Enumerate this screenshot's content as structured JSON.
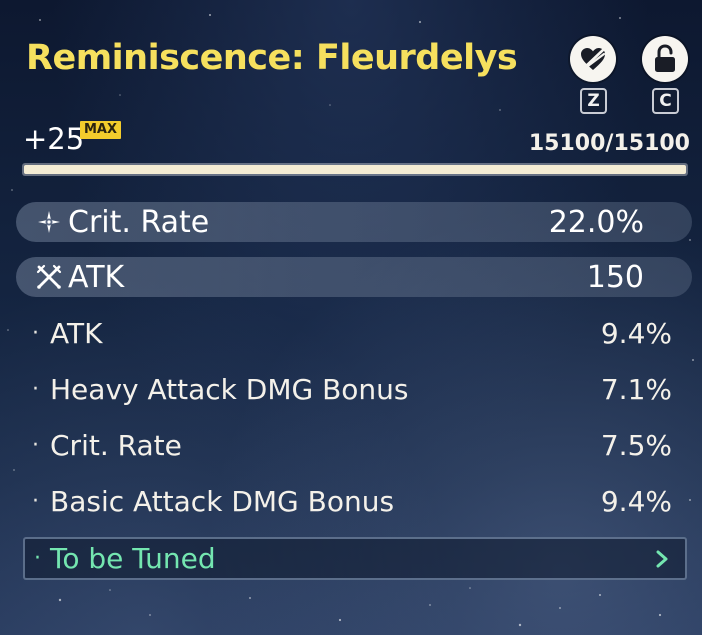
{
  "title": "Reminiscence: Fleurdelys",
  "actions": {
    "favorite_icon": "heart-slash-icon",
    "favorite_key": "Z",
    "lock_icon": "unlock-icon",
    "lock_key": "C"
  },
  "level": {
    "label": "+25",
    "badge": "MAX",
    "exp_text": "15100/15100",
    "exp_fraction": 1.0
  },
  "main_stats": [
    {
      "icon": "crit-star-icon",
      "label": "Crit. Rate",
      "value": "22.0%"
    },
    {
      "icon": "crossed-swords-icon",
      "label": "ATK",
      "value": "150"
    }
  ],
  "sub_stats": [
    {
      "bullet": "·",
      "label": "ATK",
      "value": "9.4%"
    },
    {
      "bullet": "·",
      "label": "Heavy Attack DMG Bonus",
      "value": "7.1%"
    },
    {
      "bullet": "·",
      "label": "Crit. Rate",
      "value": "7.5%"
    },
    {
      "bullet": "·",
      "label": "Basic Attack DMG Bonus",
      "value": "9.4%"
    }
  ],
  "tune": {
    "bullet": "·",
    "label": "To be Tuned",
    "icon": "chevron-right-icon"
  },
  "colors": {
    "title": "#f6e05e",
    "badge": "#f3cc2c",
    "tune": "#74e6b0"
  }
}
